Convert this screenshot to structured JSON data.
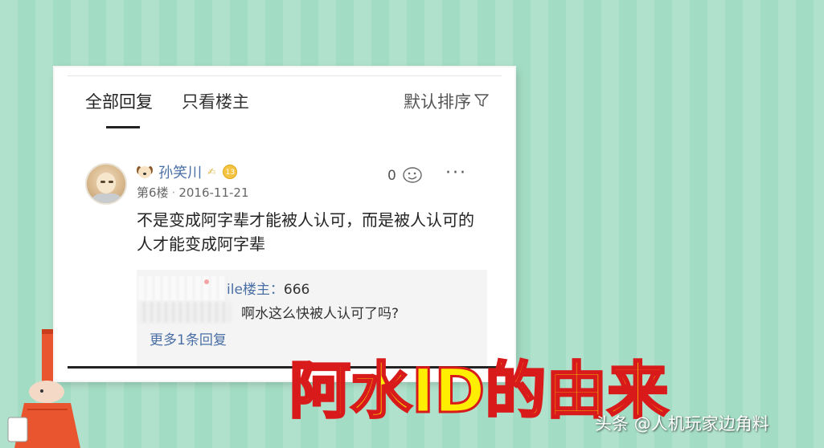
{
  "tabs": {
    "all_replies": "全部回复",
    "owner_only": "只看楼主"
  },
  "sort": {
    "label": "默认排序",
    "icon": "filter-icon"
  },
  "post": {
    "username": "孙笑川",
    "level": "13",
    "floor": "第6楼",
    "date": "2016-11-21",
    "likes": "0",
    "more": "···",
    "content": "不是变成阿字辈才能被人认可，而是被人认可的人才能变成阿字辈"
  },
  "replies": {
    "reply1_visible": "ile",
    "reply1_role": "楼主：",
    "reply1_text": "666",
    "reply2_text": "啊水这么快被人认可了吗?",
    "more_label": "更多1条回复"
  },
  "overlay": {
    "title": "阿水ID的由来"
  },
  "watermark": "头条 @人机玩家边角料",
  "colors": {
    "background": "#a3dcc4",
    "link": "#4a6fa5",
    "title_fill": "#ffee00",
    "title_stroke": "#d81a1a"
  }
}
